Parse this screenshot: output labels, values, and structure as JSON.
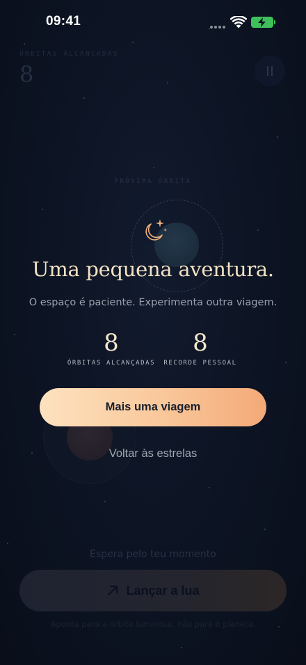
{
  "status_bar": {
    "time": "09:41"
  },
  "game": {
    "score_label": "ÓRBITAS ALCANÇADAS",
    "score_value": "8",
    "next_orbit_label": "PRÓXIMA ÓRBITA",
    "hint": "Espera pelo teu momento",
    "launch_label": "Lançar a lua",
    "instruction": "Aponta para a órbita luminosa, não para o planeta."
  },
  "modal": {
    "icon": "moon-stars-icon",
    "title": "Uma pequena aventura.",
    "subtitle": "O espaço é paciente. Experimenta outra viagem.",
    "stats": [
      {
        "value": "8",
        "label": "ÓRBITAS ALCANÇADAS"
      },
      {
        "value": "8",
        "label": "RECORDE PESSOAL"
      }
    ],
    "primary_button": "Mais uma viagem",
    "secondary_link": "Voltar às estrelas"
  },
  "colors": {
    "background": "#0b1120",
    "accent_start": "#fde2bf",
    "accent_end": "#f4a977",
    "title": "#f2e1c3",
    "battery": "#3ec15a"
  }
}
